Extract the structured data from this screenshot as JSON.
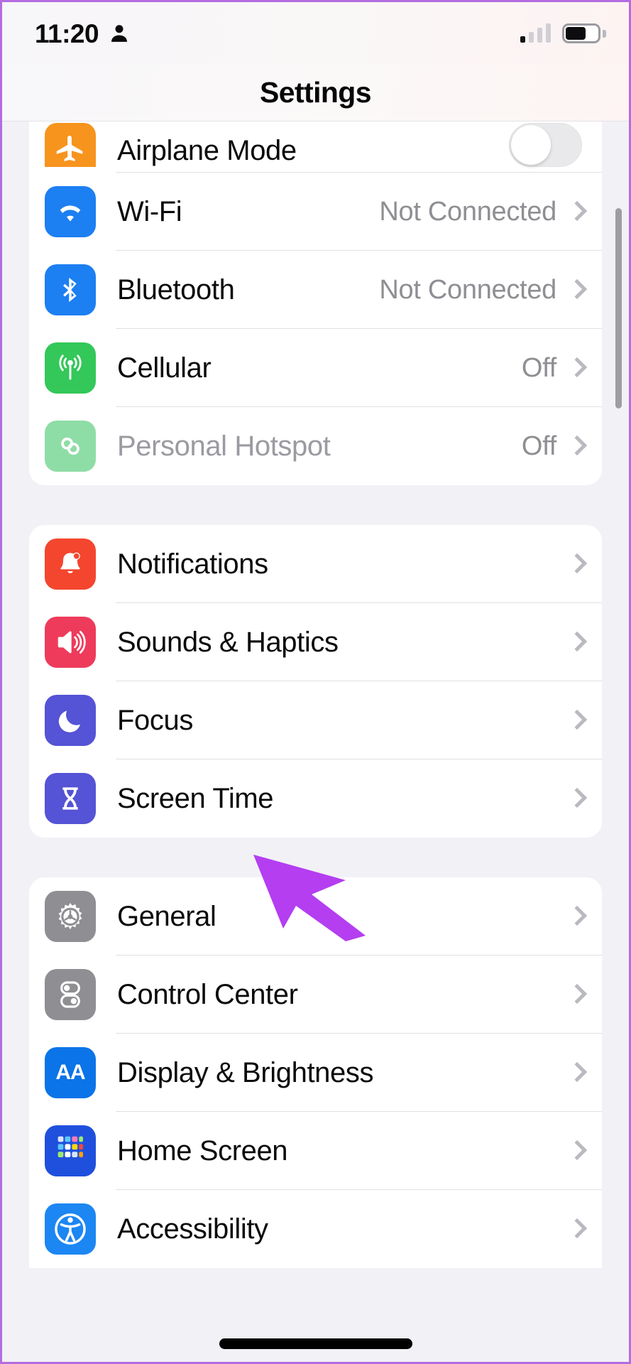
{
  "status_bar": {
    "time": "11:20",
    "person_icon": "person-icon",
    "signal_icon": "cellular-signal-icon",
    "signal_bars_total": 4,
    "signal_bars_active": 1,
    "battery_icon": "battery-icon",
    "battery_level_percent": 70
  },
  "nav": {
    "title": "Settings"
  },
  "colors": {
    "page_background": "#f2f1f6",
    "card_background": "#ffffff",
    "accent_cursor": "#b43ef0",
    "value_text": "#8e8e93",
    "airplane": "#f7941e",
    "wifi": "#1c7ff2",
    "bluetooth": "#1c7ff2",
    "cellular": "#34c759",
    "hotspot": "#8fdda6",
    "notifications": "#f4462e",
    "sounds": "#ee3b5b",
    "focus": "#5553d6",
    "screentime": "#5553d6",
    "general": "#8e8e93",
    "control_center": "#8e8e93",
    "display": "#0b74e8",
    "home_screen": "#1f50dd",
    "accessibility": "#1c86f2",
    "border_frame": "#b46ce0"
  },
  "groups": [
    {
      "name": "connectivity",
      "clipped_top": true,
      "rows": [
        {
          "label": "Airplane Mode",
          "icon": "airplane-icon",
          "control": "toggle",
          "toggle_on": false,
          "value": "",
          "chevron": false,
          "disabled": false,
          "partial": true
        },
        {
          "label": "Wi-Fi",
          "icon": "wifi-icon",
          "control": "value",
          "value": "Not Connected",
          "chevron": true,
          "disabled": false
        },
        {
          "label": "Bluetooth",
          "icon": "bluetooth-icon",
          "control": "value",
          "value": "Not Connected",
          "chevron": true,
          "disabled": false
        },
        {
          "label": "Cellular",
          "icon": "cellular-icon",
          "control": "value",
          "value": "Off",
          "chevron": true,
          "disabled": false
        },
        {
          "label": "Personal Hotspot",
          "icon": "hotspot-icon",
          "control": "value",
          "value": "Off",
          "chevron": true,
          "disabled": true
        }
      ]
    },
    {
      "name": "alerts",
      "rows": [
        {
          "label": "Notifications",
          "icon": "bell-icon",
          "control": "chevron",
          "value": "",
          "chevron": true,
          "disabled": false
        },
        {
          "label": "Sounds & Haptics",
          "icon": "speaker-icon",
          "control": "chevron",
          "value": "",
          "chevron": true,
          "disabled": false
        },
        {
          "label": "Focus",
          "icon": "moon-icon",
          "control": "chevron",
          "value": "",
          "chevron": true,
          "disabled": false
        },
        {
          "label": "Screen Time",
          "icon": "hourglass-icon",
          "control": "chevron",
          "value": "",
          "chevron": true,
          "disabled": false
        }
      ]
    },
    {
      "name": "system",
      "clipped_bottom": true,
      "rows": [
        {
          "label": "General",
          "icon": "gear-icon",
          "control": "chevron",
          "value": "",
          "chevron": true,
          "disabled": false
        },
        {
          "label": "Control Center",
          "icon": "sliders-icon",
          "control": "chevron",
          "value": "",
          "chevron": true,
          "disabled": false
        },
        {
          "label": "Display & Brightness",
          "icon": "aa-icon",
          "control": "chevron",
          "value": "",
          "chevron": true,
          "disabled": false
        },
        {
          "label": "Home Screen",
          "icon": "app-grid-icon",
          "control": "chevron",
          "value": "",
          "chevron": true,
          "disabled": false
        },
        {
          "label": "Accessibility",
          "icon": "accessibility-icon",
          "control": "chevron",
          "value": "",
          "chevron": true,
          "disabled": false
        }
      ]
    }
  ],
  "annotation": {
    "cursor_icon": "mouse-cursor-arrow",
    "points_at": "Screen Time"
  },
  "scrollbar": {
    "name": "vertical-scrollbar"
  },
  "home_indicator": {
    "name": "home-indicator"
  }
}
